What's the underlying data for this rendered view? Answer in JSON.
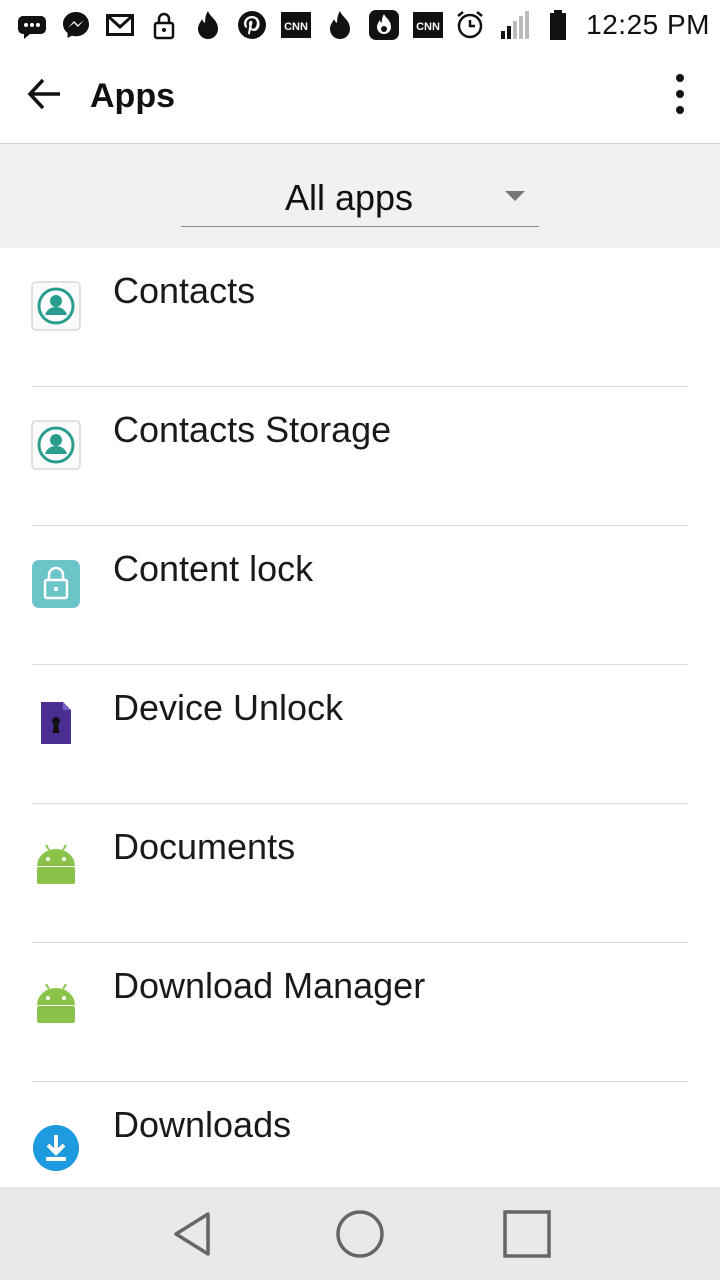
{
  "status_bar": {
    "notification_icons": [
      "more-messages-icon",
      "messenger-icon",
      "gmail-icon",
      "lock-icon",
      "tinder-icon",
      "pinterest-icon",
      "cnn-icon",
      "tinder-icon",
      "hot-app-icon",
      "cnn-icon"
    ],
    "status_icons": [
      "alarm-icon",
      "signal-icon",
      "battery-icon"
    ],
    "time": "12:25 PM"
  },
  "app_bar": {
    "title": "Apps",
    "back_icon": "back-arrow-icon",
    "menu_icon": "more-vert-icon"
  },
  "filter": {
    "selected": "All apps"
  },
  "apps": [
    {
      "name": "Contacts",
      "icon": "contacts-icon"
    },
    {
      "name": "Contacts Storage",
      "icon": "contacts-storage-icon"
    },
    {
      "name": "Content lock",
      "icon": "content-lock-icon"
    },
    {
      "name": "Device Unlock",
      "icon": "device-unlock-icon"
    },
    {
      "name": "Documents",
      "icon": "android-icon"
    },
    {
      "name": "Download Manager",
      "icon": "android-icon"
    },
    {
      "name": "Downloads",
      "icon": "downloads-icon"
    }
  ],
  "nav_bar": {
    "buttons": [
      "back-triangle-icon",
      "home-circle-icon",
      "recents-square-icon"
    ]
  },
  "colors": {
    "contacts_accent": "#2a9d8f",
    "content_lock": "#6cc3c8",
    "device_unlock": "#4b2e91",
    "android_green": "#8bc34a",
    "downloads_blue": "#1e9be0"
  }
}
